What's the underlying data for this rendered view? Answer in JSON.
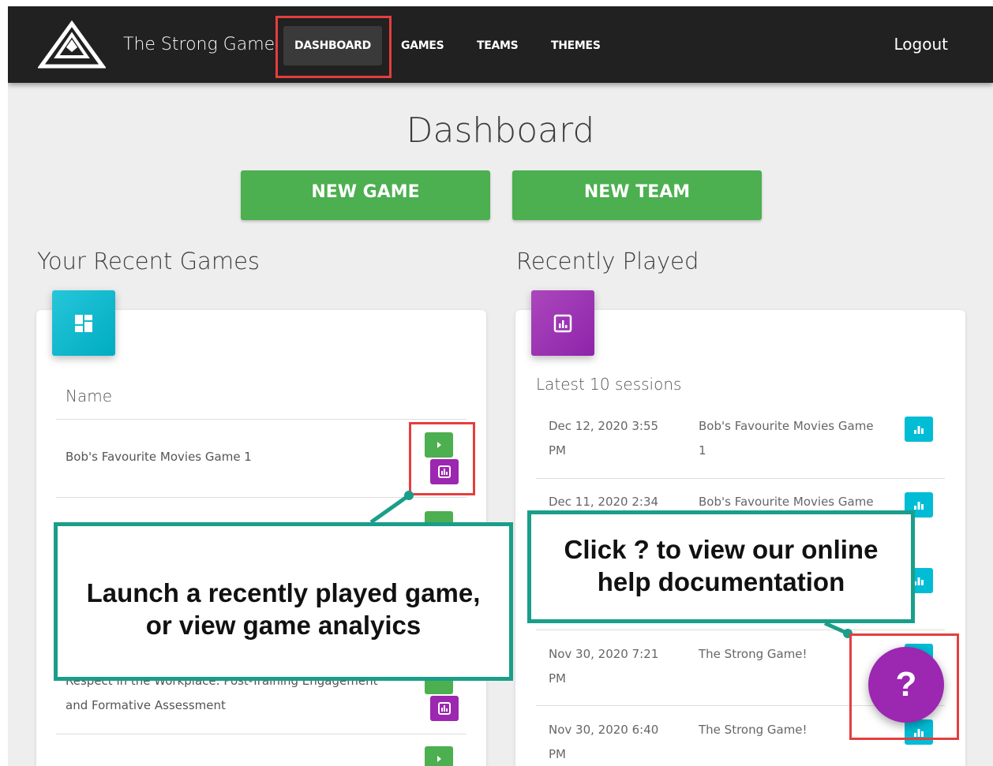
{
  "navbar": {
    "brand": "The Strong Game",
    "items": [
      {
        "label": "DASHBOARD"
      },
      {
        "label": "GAMES"
      },
      {
        "label": "TEAMS"
      },
      {
        "label": "THEMES"
      }
    ],
    "logout": "Logout"
  },
  "main": {
    "title": "Dashboard",
    "buttons": {
      "new_game": "NEW GAME",
      "new_team": "NEW TEAM"
    },
    "recent_games": {
      "title": "Your Recent Games",
      "column_header": "Name",
      "rows": [
        {
          "name": "Bob's Favourite Movies Game 1"
        },
        {
          "name_line1": "Respect in the Workplace: Post-Training Engagement",
          "name_line2": "and Formative Assessment"
        }
      ]
    },
    "recently_played": {
      "title": "Recently Played",
      "subtitle": "Latest 10 sessions",
      "sessions": [
        {
          "date_line1": "Dec 12, 2020 3:55",
          "date_line2": "PM",
          "game_line1": "Bob's Favourite Movies Game",
          "game_line2": "1"
        },
        {
          "date_line1": "Dec 11, 2020 2:34",
          "game_line1": "Bob's Favourite Movies Game"
        },
        {
          "date_line1": "Nov 30, 2020 7:21",
          "date_line2": "PM",
          "game_line1": "The Strong Game!"
        },
        {
          "date_line1": "Nov 30, 2020 6:40",
          "date_line2": "PM",
          "game_line1": "The Strong Game!"
        }
      ]
    }
  },
  "callouts": {
    "left_line1": "Launch a recently played game,",
    "left_line2": "or view game analyics",
    "right_line1": "Click ? to view our online",
    "right_line2": "help documentation"
  },
  "help_button": "?",
  "colors": {
    "navbar": "#212121",
    "green": "#4caf50",
    "purple": "#9c27b0",
    "cyan": "#00bcd4",
    "callout_border": "#1a9e8a",
    "highlight": "#e53e3e"
  }
}
